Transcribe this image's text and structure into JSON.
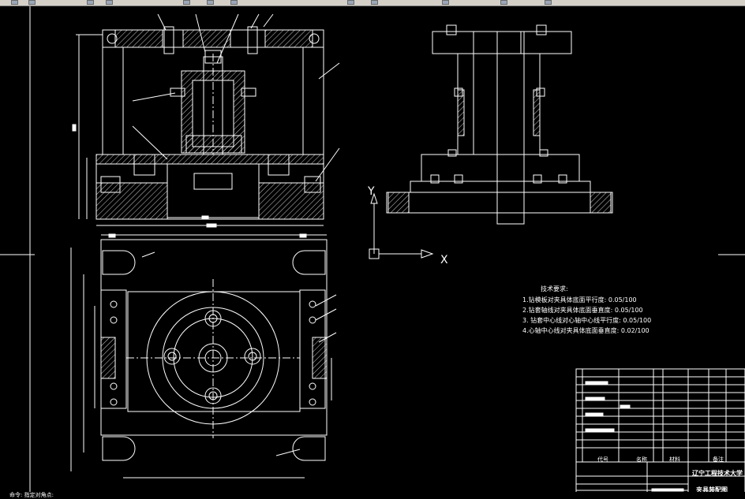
{
  "tech_requirements": {
    "title": "技术要求:",
    "items": [
      "1.钻模板对夹具体底面平行度: 0.05/100",
      "2.钻套轴线对夹具体底面垂直度: 0.05/100",
      "3. 钻套中心线对心轴中心线平行度: 0.05/100",
      "4.心轴中心线对夹具体底面垂直度: 0.02/100"
    ]
  },
  "ucs": {
    "y_label": "Y",
    "x_label": "X"
  },
  "title_block": {
    "school": "辽宁工程技术大学",
    "drawing_name": "夹具装配图",
    "headers": [
      "代号",
      "名称",
      "材料",
      "备注"
    ]
  },
  "command_line": "命令: 指定对角点:",
  "colors": {
    "background": "#000000",
    "lines": "#ffffff",
    "toolbar": "#d4d0c8"
  }
}
